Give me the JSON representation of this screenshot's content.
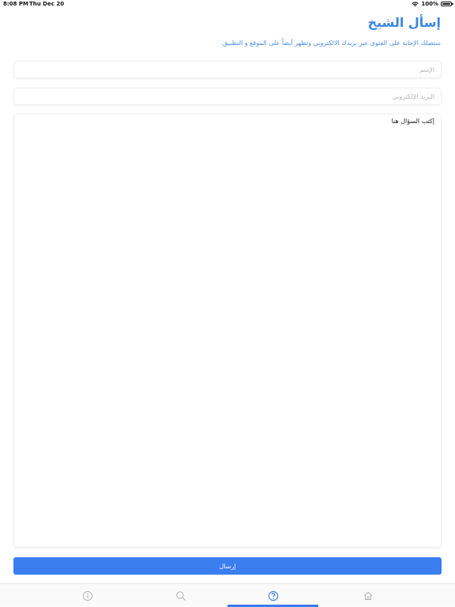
{
  "status_bar": {
    "time": "8:08 PM",
    "date": "Thu Dec 20",
    "battery": "100%"
  },
  "page": {
    "title": "إسأل الشيخ",
    "subtitle": "ستصلك  الإجابة على الفتوى عبر بريدك الالكتروني وتظهر أيضاً على الموقع و التطبيق."
  },
  "form": {
    "name_placeholder": "الإسم",
    "email_placeholder": "البريد الإلكتروني",
    "question_placeholder": "إكتب السؤال هنا",
    "submit_label": "إرسال"
  },
  "tabs": [
    {
      "name": "info",
      "icon": "info-icon",
      "active": false
    },
    {
      "name": "search",
      "icon": "search-icon",
      "active": false
    },
    {
      "name": "ask",
      "icon": "question-icon",
      "active": true
    },
    {
      "name": "home",
      "icon": "home-icon",
      "active": false
    }
  ],
  "colors": {
    "accent": "#3a7ef0",
    "title": "#3a86e6",
    "inactive_icon": "#b0b0b0"
  }
}
